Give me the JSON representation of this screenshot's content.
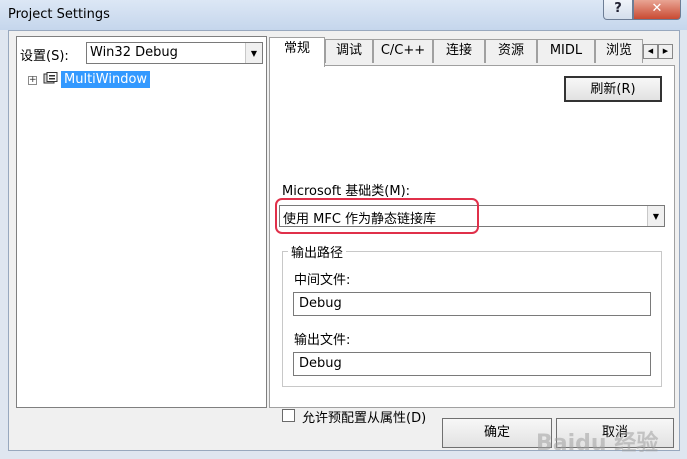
{
  "window": {
    "title": "Project Settings",
    "help_label": "?",
    "close_label": "✕"
  },
  "left": {
    "settings_label": "设置(S):",
    "settings_value": "Win32 Debug",
    "tree_item": "MultiWindow",
    "expander": "+"
  },
  "tabs": [
    {
      "label": "常规",
      "active": true
    },
    {
      "label": "调试",
      "active": false
    },
    {
      "label": "C/C++",
      "active": false
    },
    {
      "label": "连接",
      "active": false
    },
    {
      "label": "资源",
      "active": false
    },
    {
      "label": "MIDL",
      "active": false
    },
    {
      "label": "浏览",
      "active": false
    }
  ],
  "tab_scroll": {
    "left": "◀",
    "right": "▶"
  },
  "general": {
    "refresh_label": "刷新(R)",
    "mfc_label": "Microsoft 基础类(M):",
    "mfc_value": "使用 MFC 作为静态链接库",
    "output_group": "输出路径",
    "intermediate_label": "中间文件:",
    "intermediate_value": "Debug",
    "output_label": "输出文件:",
    "output_value": "Debug",
    "allow_preconfig_label": "允许预配置从属性(D)",
    "allow_preconfig_checked": false
  },
  "buttons": {
    "ok": "确定",
    "cancel": "取消"
  },
  "watermark": "Baidu 经验",
  "colors": {
    "highlight": "#e0304a",
    "selection": "#3399ff"
  }
}
